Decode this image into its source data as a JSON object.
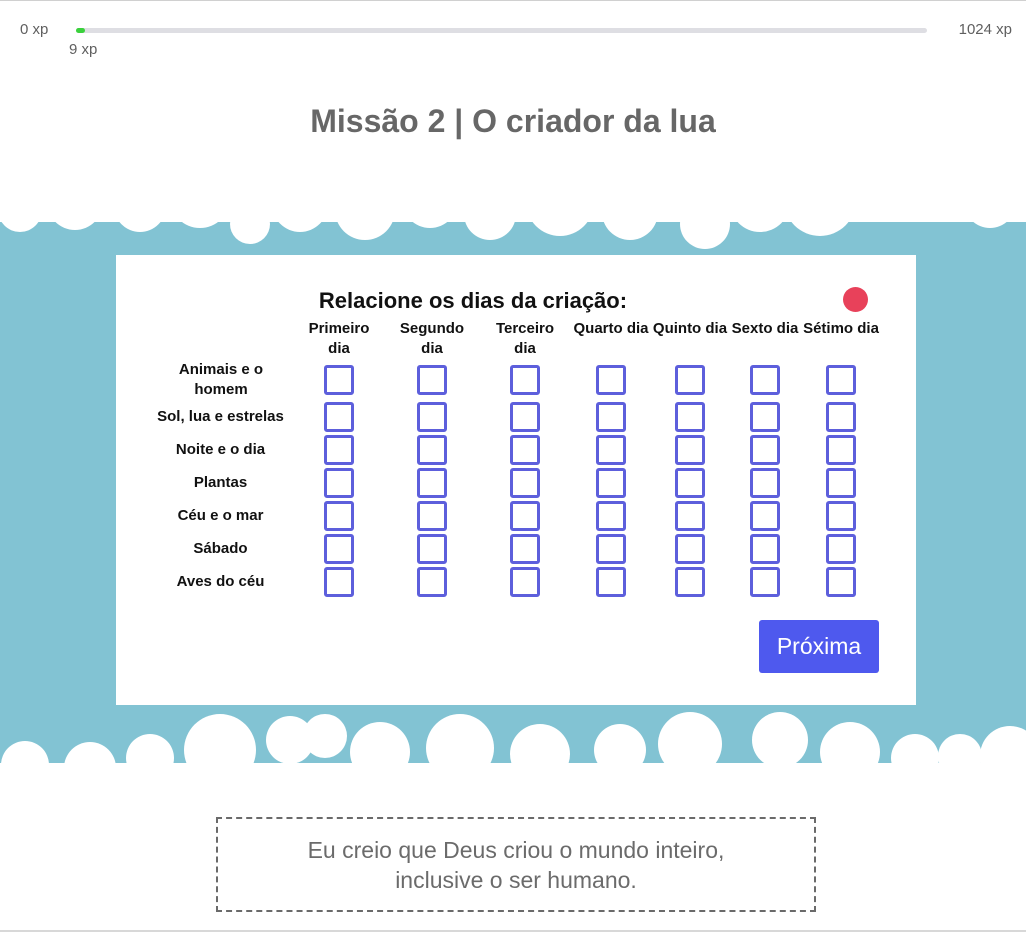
{
  "progress": {
    "min_label": "0 xp",
    "max_label": "1024 xp",
    "current_label": "9 xp",
    "current_xp": 9,
    "max_xp": 1024,
    "fill_color": "#3ad13c"
  },
  "mission": {
    "title": "Missão 2 | O criador da lua"
  },
  "question": {
    "title": "Relacione os dias da criação:",
    "status_color": "#e8415a",
    "columns": [
      "Primeiro dia",
      "Segundo dia",
      "Terceiro dia",
      "Quarto dia",
      "Quinto dia",
      "Sexto dia",
      "Sétimo dia"
    ],
    "rows": [
      "Animais e o homem",
      "Sol, lua e estrelas",
      "Noite e o dia",
      "Plantas",
      "Céu e o mar",
      "Sábado",
      "Aves do céu"
    ],
    "checkbox_color": "#5d5fdc"
  },
  "actions": {
    "next_label": "Próxima",
    "next_color": "#4e59ee"
  },
  "verse": {
    "text": "Eu creio que Deus criou o mundo inteiro, inclusive o ser humano."
  },
  "colors": {
    "sky": "#82c3d3"
  }
}
